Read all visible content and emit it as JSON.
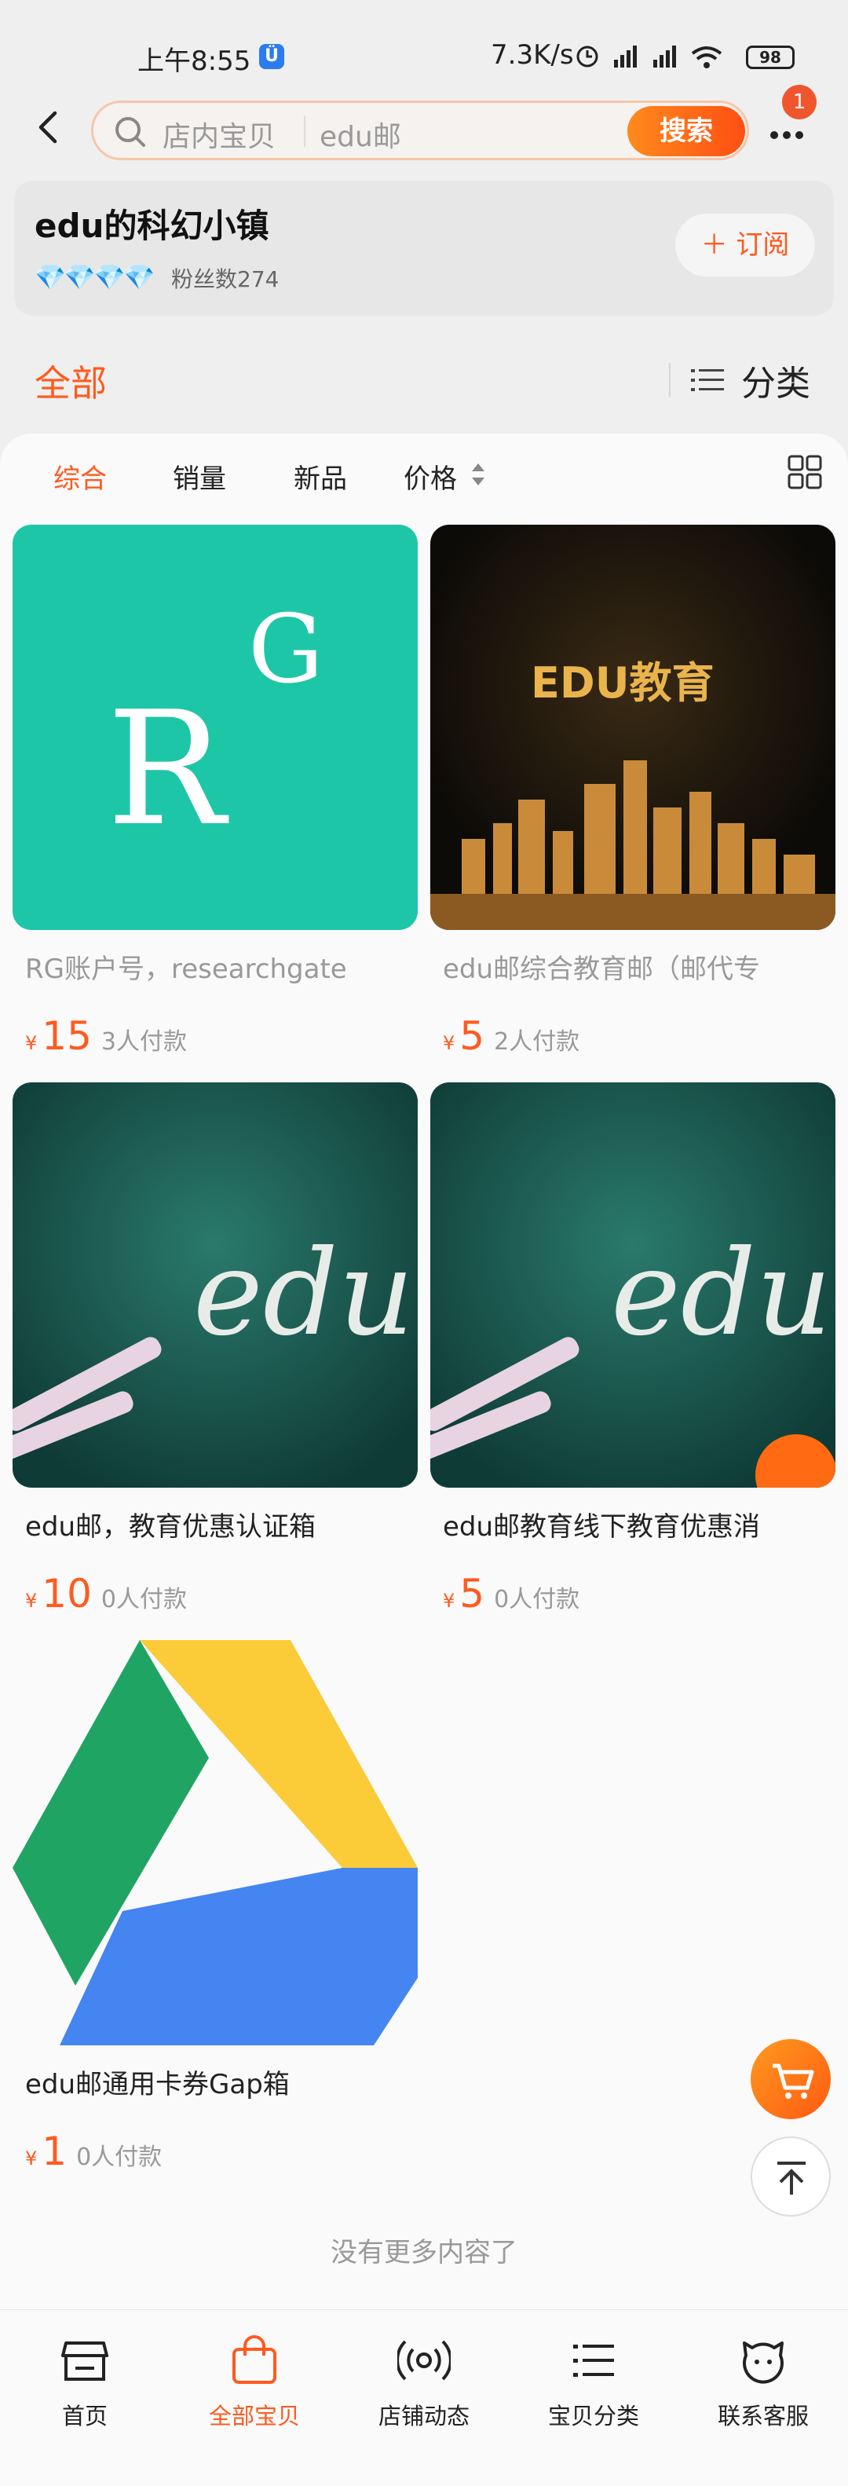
{
  "status_bar": {
    "time": "上午8:55",
    "badge": "Ü",
    "net_speed": "7.3K/s",
    "signal": "⏰ ᴴᴰ▂▄▆ ▂▄▆",
    "battery": "98"
  },
  "header": {
    "search_placeholder": "店内宝贝",
    "search_keyword": "edu邮",
    "search_button": "搜索",
    "notification_count": "1"
  },
  "shop": {
    "name": "edu的科幻小镇",
    "diamonds": "💎💎💎💎",
    "fans": "粉丝数274",
    "subscribe_label": "＋ 订阅"
  },
  "tabs": {
    "all": "全部",
    "category": "分类"
  },
  "sort": {
    "items": [
      "综合",
      "销量",
      "新品",
      "价格"
    ]
  },
  "products": [
    {
      "title": "RG账户号，researchgate",
      "price": "15",
      "paid": "3人付款",
      "image_text": "RG",
      "title_color": "grey"
    },
    {
      "title": "edu邮综合教育邮（邮代专",
      "price": "5",
      "paid": "2人付款",
      "image_text": "EDU教育",
      "title_color": "grey"
    },
    {
      "title": "edu邮，教育优惠认证箱",
      "price": "10",
      "paid": "0人付款",
      "image_text": "edu",
      "title_color": "dark"
    },
    {
      "title": "edu邮教育线下教育优惠消",
      "price": "5",
      "paid": "0人付款",
      "image_text": "edu",
      "title_color": "dark"
    },
    {
      "title": "edu邮通用卡券Gap箱",
      "price": "1",
      "paid": "0人付款",
      "image_text": "",
      "title_color": "dark"
    }
  ],
  "currency": "¥",
  "footer_text": "没有更多内容了",
  "bottom_nav": [
    {
      "label": "首页",
      "icon": "store-icon"
    },
    {
      "label": "全部宝贝",
      "icon": "bag-icon"
    },
    {
      "label": "店铺动态",
      "icon": "broadcast-icon"
    },
    {
      "label": "宝贝分类",
      "icon": "list-icon"
    },
    {
      "label": "联系客服",
      "icon": "chat-icon"
    }
  ],
  "colors": {
    "accent": "#ff5a1f",
    "rg_green": "#1ec6a8",
    "chalkboard": "#1b5a52"
  }
}
